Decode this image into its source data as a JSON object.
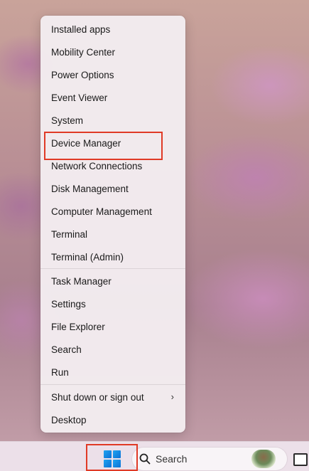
{
  "menu": {
    "group1": [
      "Installed apps",
      "Mobility Center",
      "Power Options",
      "Event Viewer",
      "System",
      "Device Manager",
      "Network Connections",
      "Disk Management",
      "Computer Management",
      "Terminal",
      "Terminal (Admin)"
    ],
    "group2": [
      "Task Manager",
      "Settings",
      "File Explorer",
      "Search",
      "Run"
    ],
    "group3": [
      "Shut down or sign out",
      "Desktop"
    ],
    "submenu_chevron": "›"
  },
  "taskbar": {
    "search_label": "Search",
    "start_icon": "windows-start-icon",
    "search_icon": "search-icon"
  },
  "colors": {
    "highlight": "#e03a26",
    "windows_blue": "#0d72d6"
  }
}
